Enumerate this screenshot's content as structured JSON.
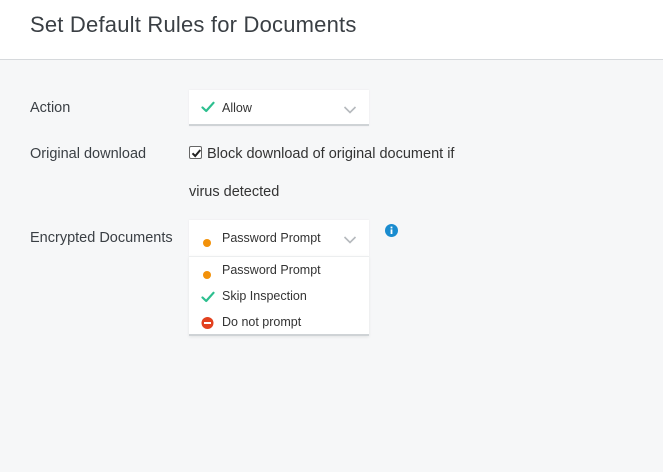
{
  "header": {
    "title": "Set Default Rules for Documents"
  },
  "action": {
    "label": "Action",
    "selected": "Allow",
    "selected_icon": "check-icon"
  },
  "original_download": {
    "label": "Original download",
    "checked": true,
    "checkbox_text_line1": "Block download of original document if",
    "checkbox_text_line2": "virus detected"
  },
  "encrypted_documents": {
    "label": "Encrypted Documents",
    "selected": "Password Prompt",
    "selected_icon": "orange-dot-icon",
    "open": true,
    "options": [
      {
        "label": "Password Prompt",
        "icon": "orange-dot-icon"
      },
      {
        "label": "Skip Inspection",
        "icon": "check-icon"
      },
      {
        "label": "Do not prompt",
        "icon": "no-entry-icon"
      }
    ]
  },
  "colors": {
    "check_green": "#2dbf8f",
    "prompt_orange": "#f2910a",
    "block_red": "#e2411f",
    "info_blue": "#1a8ccf",
    "chevron_gray": "#b5b9bd"
  }
}
